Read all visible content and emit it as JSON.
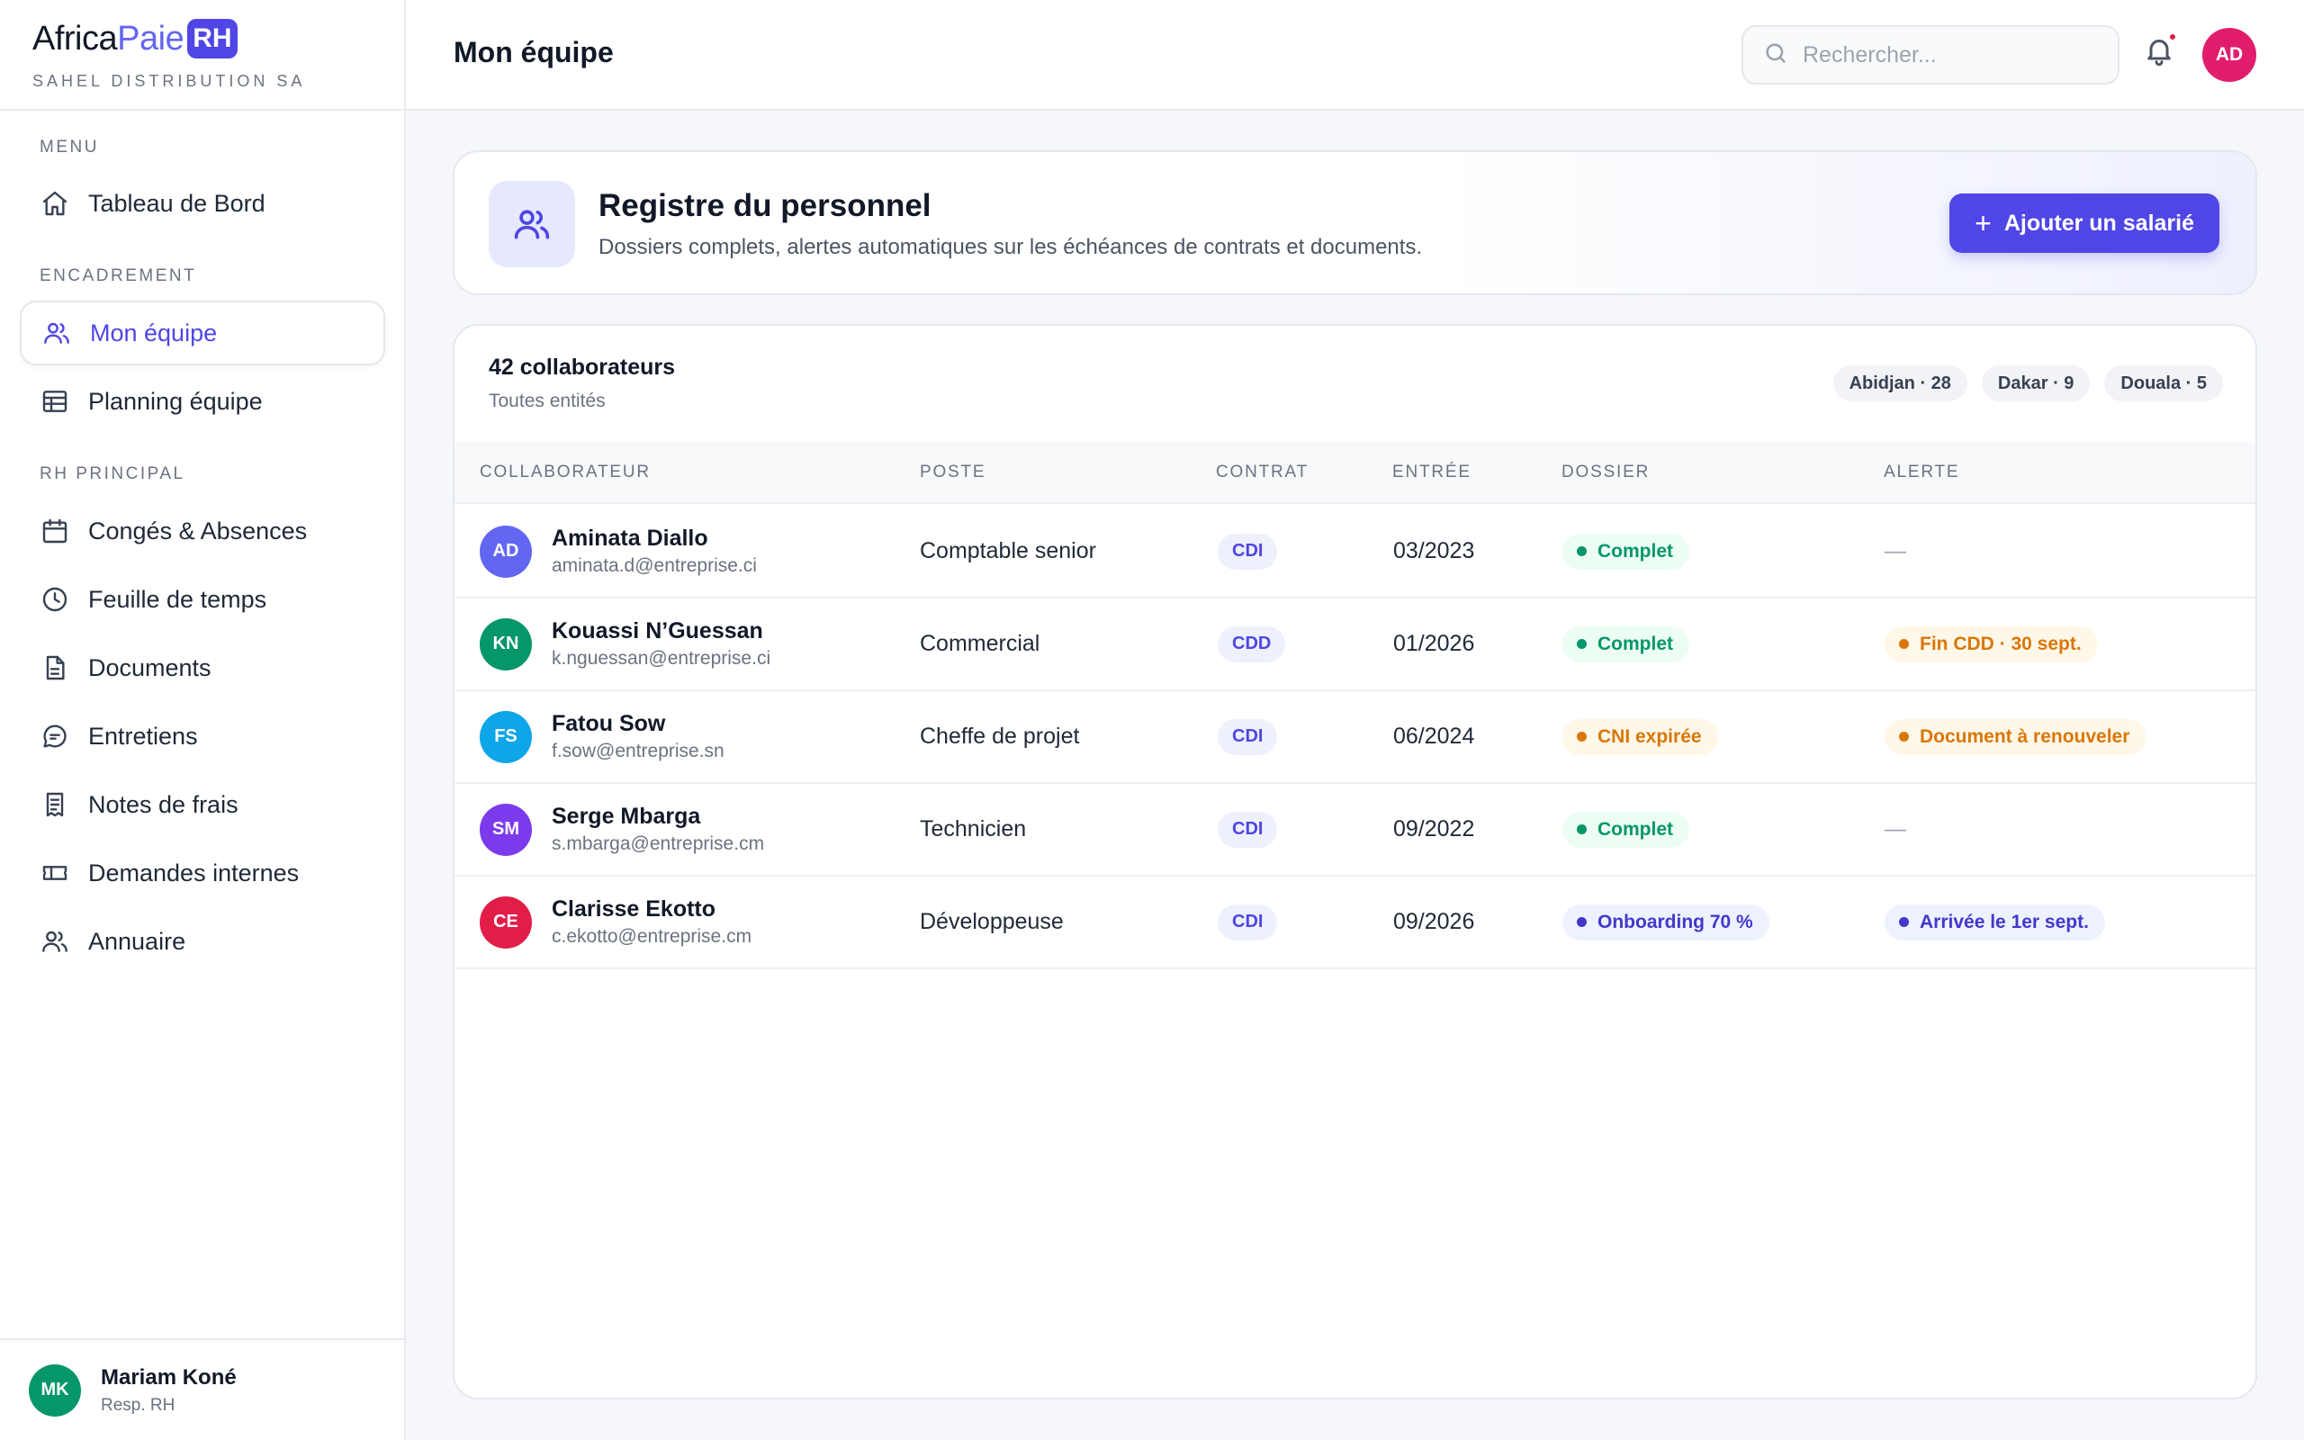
{
  "brand": {
    "name_part1": "Africa",
    "name_part2": "Paie",
    "badge": "RH",
    "company": "SAHEL DISTRIBUTION SA"
  },
  "sidebar": {
    "sections": [
      {
        "label": "MENU"
      },
      {
        "label": "ENCADREMENT"
      },
      {
        "label": "RH PRINCIPAL"
      }
    ],
    "items": [
      {
        "label": "Tableau de Bord",
        "icon": "home-icon"
      },
      {
        "label": "Mon équipe",
        "icon": "users-icon",
        "active": true
      },
      {
        "label": "Planning équipe",
        "icon": "table-icon"
      },
      {
        "label": "Congés & Absences",
        "icon": "calendar-icon"
      },
      {
        "label": "Feuille de temps",
        "icon": "clock-icon"
      },
      {
        "label": "Documents",
        "icon": "document-icon"
      },
      {
        "label": "Entretiens",
        "icon": "chat-icon"
      },
      {
        "label": "Notes de frais",
        "icon": "receipt-icon"
      },
      {
        "label": "Demandes internes",
        "icon": "ticket-icon"
      },
      {
        "label": "Annuaire",
        "icon": "users-icon"
      }
    ]
  },
  "user": {
    "initials": "MK",
    "name": "Mariam Koné",
    "role": "Resp. RH",
    "color": "#059669"
  },
  "header": {
    "title": "Mon équipe",
    "search_placeholder": "Rechercher...",
    "avatar_initials": "AD",
    "avatar_color": "#e11d6b",
    "has_notification": true
  },
  "hero": {
    "title": "Registre du personnel",
    "description": "Dossiers complets, alertes automatiques sur les échéances de contrats et documents.",
    "button_label": "Ajouter un salarié"
  },
  "team": {
    "count_label": "42 collaborateurs",
    "subtitle": "Toutes entités",
    "chips": [
      "Abidjan · 28",
      "Dakar · 9",
      "Douala · 5"
    ],
    "columns": [
      "COLLABORATEUR",
      "POSTE",
      "CONTRAT",
      "ENTRÉE",
      "DOSSIER",
      "ALERTE"
    ],
    "rows": [
      {
        "initials": "AD",
        "color": "#6366f1",
        "name": "Aminata Diallo",
        "email": "aminata.d@entreprise.ci",
        "poste": "Comptable senior",
        "contrat": "CDI",
        "entree": "03/2023",
        "dossier": "Complet",
        "dossier_status": "green",
        "alerte": "—",
        "alerte_status": "none"
      },
      {
        "initials": "KN",
        "color": "#059669",
        "name": "Kouassi N’Guessan",
        "email": "k.nguessan@entreprise.ci",
        "poste": "Commercial",
        "contrat": "CDD",
        "entree": "01/2026",
        "dossier": "Complet",
        "dossier_status": "green",
        "alerte": "Fin CDD · 30 sept.",
        "alerte_status": "orange"
      },
      {
        "initials": "FS",
        "color": "#0ea5e9",
        "name": "Fatou Sow",
        "email": "f.sow@entreprise.sn",
        "poste": "Cheffe de projet",
        "contrat": "CDI",
        "entree": "06/2024",
        "dossier": "CNI expirée",
        "dossier_status": "orange",
        "alerte": "Document à renouveler",
        "alerte_status": "orange"
      },
      {
        "initials": "SM",
        "color": "#7c3aed",
        "name": "Serge Mbarga",
        "email": "s.mbarga@entreprise.cm",
        "poste": "Technicien",
        "contrat": "CDI",
        "entree": "09/2022",
        "dossier": "Complet",
        "dossier_status": "green",
        "alerte": "—",
        "alerte_status": "none"
      },
      {
        "initials": "CE",
        "color": "#e11d48",
        "name": "Clarisse Ekotto",
        "email": "c.ekotto@entreprise.cm",
        "poste": "Développeuse",
        "contrat": "CDI",
        "entree": "09/2026",
        "dossier": "Onboarding 70 %",
        "dossier_status": "blue",
        "alerte": "Arrivée le 1er sept.",
        "alerte_status": "blue"
      }
    ]
  }
}
